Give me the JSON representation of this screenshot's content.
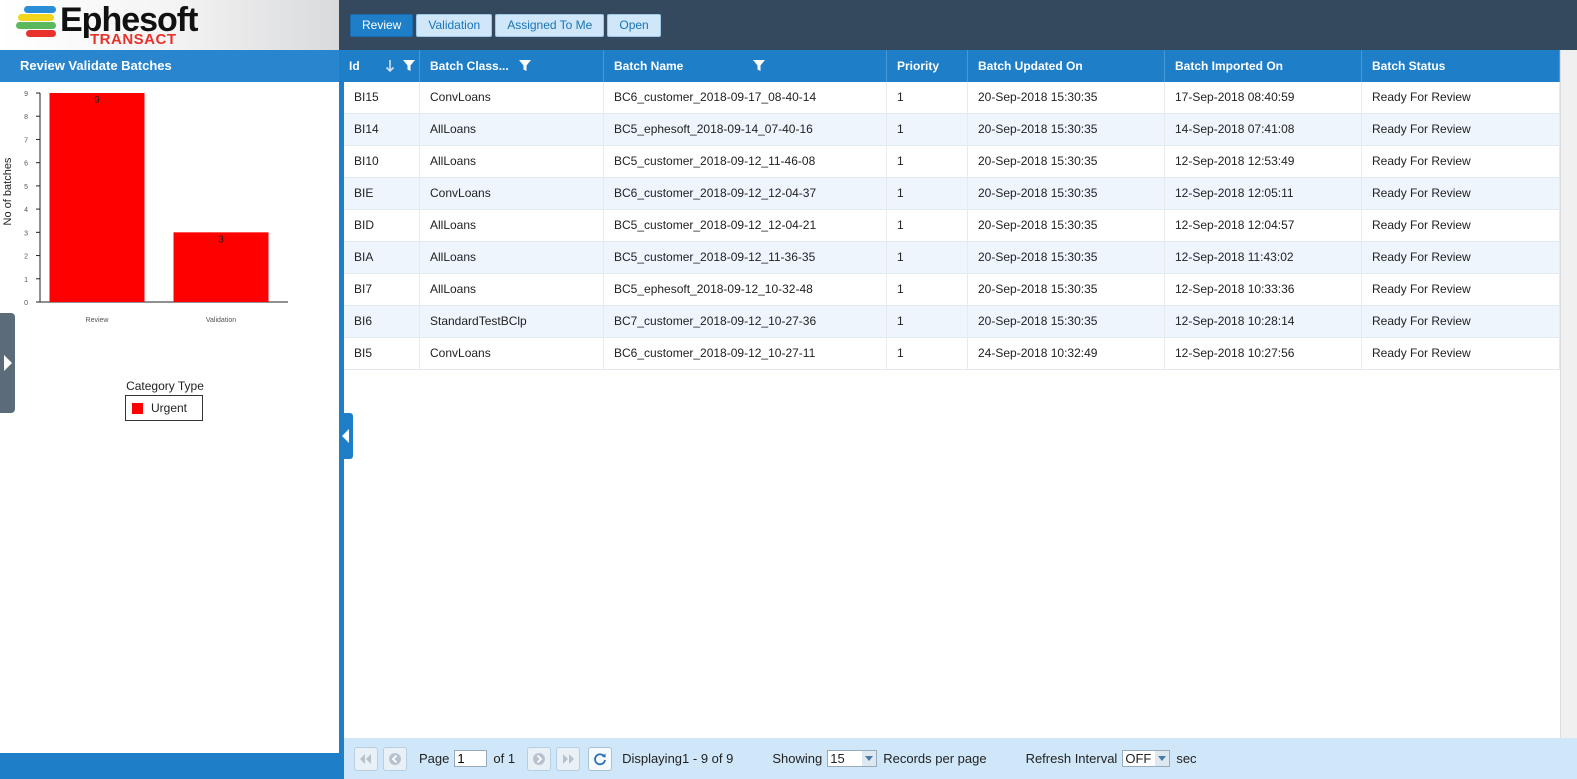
{
  "brand": {
    "name": "Ephesoft",
    "sub": "TRANSACT",
    "stripe_colors": [
      "#2b8fd8",
      "#f2d51c",
      "#5cb85c",
      "#e8322b"
    ]
  },
  "tabs": [
    {
      "label": "Review",
      "active": true
    },
    {
      "label": "Validation",
      "active": false
    },
    {
      "label": "Assigned To Me",
      "active": false
    },
    {
      "label": "Open",
      "active": false
    }
  ],
  "left_panel": {
    "title": "Review Validate Batches"
  },
  "chart_data": {
    "type": "bar",
    "categories": [
      "Review",
      "Validation"
    ],
    "series": [
      {
        "name": "Urgent",
        "values": [
          9,
          3
        ],
        "color": "#ff0000"
      }
    ],
    "ylabel": "No of batches",
    "xlabel": "Category Type",
    "ylim": [
      0,
      9
    ],
    "yticks": [
      0,
      1,
      2,
      3,
      4,
      5,
      6,
      7,
      8,
      9
    ],
    "data_labels": [
      "9",
      "3"
    ],
    "legend": "bottom"
  },
  "grid": {
    "columns": [
      "Id",
      "Batch Class...",
      "Batch Name",
      "Priority",
      "Batch Updated On",
      "Batch Imported On",
      "Batch Status"
    ],
    "rows": [
      [
        "BI15",
        "ConvLoans",
        "BC6_customer_2018-09-17_08-40-14",
        "1",
        "20-Sep-2018 15:30:35",
        "17-Sep-2018 08:40:59",
        "Ready For Review"
      ],
      [
        "BI14",
        "AllLoans",
        "BC5_ephesoft_2018-09-14_07-40-16",
        "1",
        "20-Sep-2018 15:30:35",
        "14-Sep-2018 07:41:08",
        "Ready For Review"
      ],
      [
        "BI10",
        "AllLoans",
        "BC5_customer_2018-09-12_11-46-08",
        "1",
        "20-Sep-2018 15:30:35",
        "12-Sep-2018 12:53:49",
        "Ready For Review"
      ],
      [
        "BIE",
        "ConvLoans",
        "BC6_customer_2018-09-12_12-04-37",
        "1",
        "20-Sep-2018 15:30:35",
        "12-Sep-2018 12:05:11",
        "Ready For Review"
      ],
      [
        "BID",
        "AllLoans",
        "BC5_customer_2018-09-12_12-04-21",
        "1",
        "20-Sep-2018 15:30:35",
        "12-Sep-2018 12:04:57",
        "Ready For Review"
      ],
      [
        "BIA",
        "AllLoans",
        "BC5_customer_2018-09-12_11-36-35",
        "1",
        "20-Sep-2018 15:30:35",
        "12-Sep-2018 11:43:02",
        "Ready For Review"
      ],
      [
        "BI7",
        "AllLoans",
        "BC5_ephesoft_2018-09-12_10-32-48",
        "1",
        "20-Sep-2018 15:30:35",
        "12-Sep-2018 10:33:36",
        "Ready For Review"
      ],
      [
        "BI6",
        "StandardTestBClp",
        "BC7_customer_2018-09-12_10-27-36",
        "1",
        "20-Sep-2018 15:30:35",
        "12-Sep-2018 10:28:14",
        "Ready For Review"
      ],
      [
        "BI5",
        "ConvLoans",
        "BC6_customer_2018-09-12_10-27-11",
        "1",
        "24-Sep-2018 10:32:49",
        "12-Sep-2018 10:27:56",
        "Ready For Review"
      ]
    ]
  },
  "pager": {
    "page_label": "Page",
    "page_value": "1",
    "of_label": "of 1",
    "displaying": "Displaying1 - 9 of 9",
    "showing_label": "Showing",
    "records_value": "15",
    "records_label": "Records per page",
    "refresh_label": "Refresh Interval",
    "refresh_value": "OFF",
    "sec_label": "sec"
  }
}
